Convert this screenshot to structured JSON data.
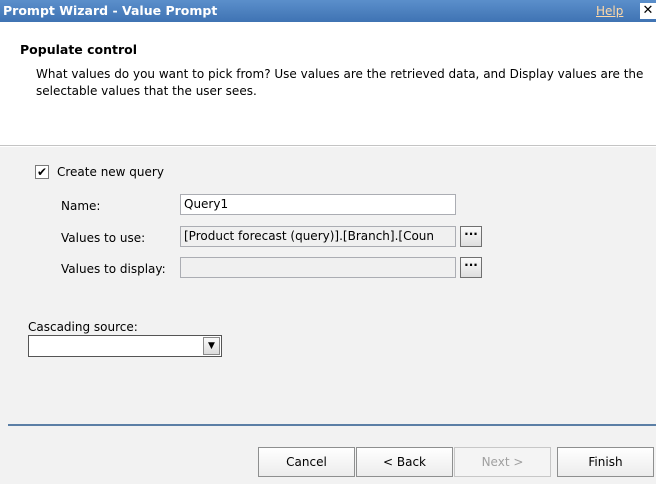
{
  "window": {
    "title": "Prompt Wizard - Value Prompt",
    "help_label": "Help",
    "close_glyph": "✕"
  },
  "header": {
    "title": "Populate control",
    "description": "What values do you want to pick from? Use values are the retrieved data, and Display values are the selectable values that the user sees."
  },
  "query": {
    "create_checked": true,
    "check_glyph": "✔",
    "create_label": "Create new query",
    "name_label": "Name:",
    "name_value": "Query1",
    "use_label": "Values to use:",
    "use_value": "[Product forecast (query)].[Branch].[Coun",
    "display_label": "Values to display:",
    "display_value": "",
    "browse_glyph": "···"
  },
  "cascade": {
    "label": "Cascading source:",
    "selected": "",
    "arrow_glyph": "▼"
  },
  "buttons": {
    "cancel": "Cancel",
    "back": "< Back",
    "next": "Next >",
    "finish": "Finish"
  },
  "colors": {
    "titlebar": "#4a7ebb",
    "divider": "#5b7fa6",
    "content_bg": "#f2f2f2"
  }
}
